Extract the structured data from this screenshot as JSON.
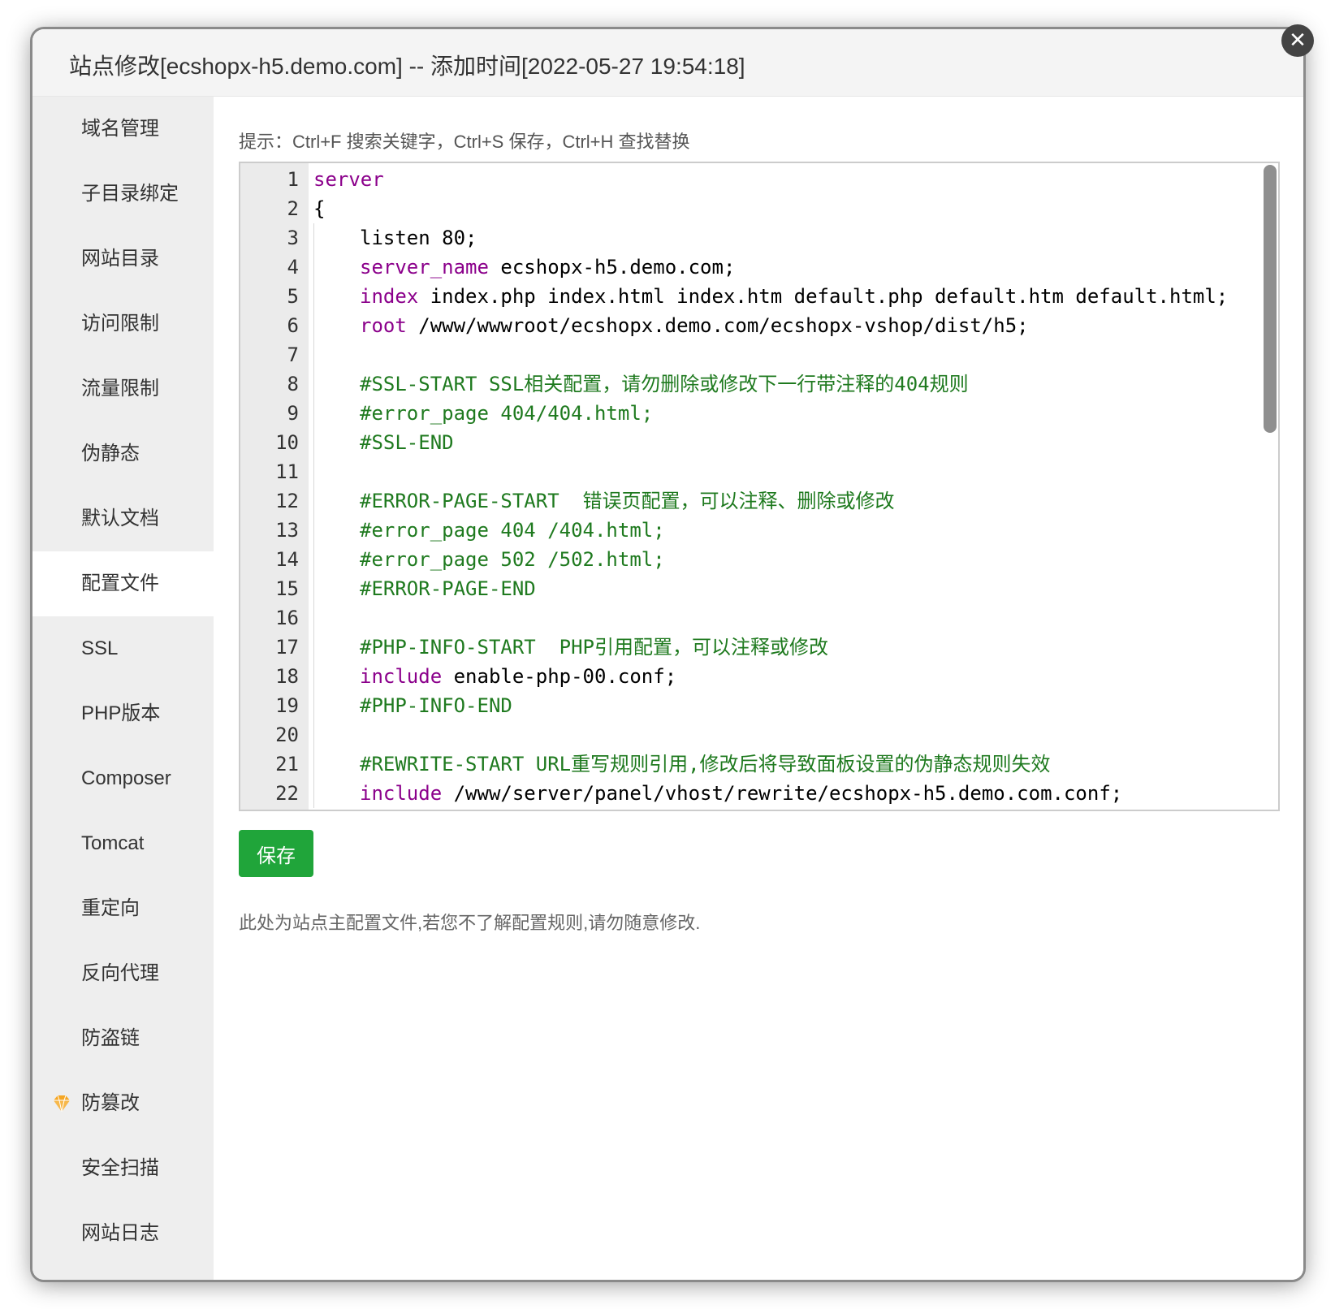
{
  "dialog": {
    "title": "站点修改[ecshopx-h5.demo.com] -- 添加时间[2022-05-27 19:54:18]",
    "close_icon": "close-icon"
  },
  "sidebar": {
    "items": [
      {
        "label": "域名管理"
      },
      {
        "label": "子目录绑定"
      },
      {
        "label": "网站目录"
      },
      {
        "label": "访问限制"
      },
      {
        "label": "流量限制"
      },
      {
        "label": "伪静态"
      },
      {
        "label": "默认文档"
      },
      {
        "label": "配置文件",
        "active": true
      },
      {
        "label": "SSL"
      },
      {
        "label": "PHP版本"
      },
      {
        "label": "Composer"
      },
      {
        "label": "Tomcat"
      },
      {
        "label": "重定向"
      },
      {
        "label": "反向代理"
      },
      {
        "label": "防盗链"
      },
      {
        "label": "防篡改",
        "icon": "gem-icon"
      },
      {
        "label": "安全扫描"
      },
      {
        "label": "网站日志"
      }
    ]
  },
  "editor": {
    "hint": "提示：Ctrl+F 搜索关键字，Ctrl+S 保存，Ctrl+H 查找替换",
    "lines": [
      {
        "n": "1",
        "indent": false,
        "kw": "server",
        "rest": "",
        "comment": ""
      },
      {
        "n": "2",
        "indent": false,
        "kw": "",
        "rest": "{",
        "comment": ""
      },
      {
        "n": "3",
        "indent": true,
        "kw": "",
        "rest": "listen 80;",
        "comment": ""
      },
      {
        "n": "4",
        "indent": true,
        "kw": "server_name",
        "rest": " ecshopx-h5.demo.com;",
        "comment": ""
      },
      {
        "n": "5",
        "indent": true,
        "kw": "index",
        "rest": " index.php index.html index.htm default.php default.htm default.html;",
        "comment": ""
      },
      {
        "n": "6",
        "indent": true,
        "kw": "root",
        "rest": " /www/wwwroot/ecshopx.demo.com/ecshopx-vshop/dist/h5;",
        "comment": ""
      },
      {
        "n": "7",
        "indent": true,
        "kw": "",
        "rest": "",
        "comment": ""
      },
      {
        "n": "8",
        "indent": true,
        "kw": "",
        "rest": "",
        "comment": "#SSL-START SSL相关配置，请勿删除或修改下一行带注释的404规则"
      },
      {
        "n": "9",
        "indent": true,
        "kw": "",
        "rest": "",
        "comment": "#error_page 404/404.html;"
      },
      {
        "n": "10",
        "indent": true,
        "kw": "",
        "rest": "",
        "comment": "#SSL-END"
      },
      {
        "n": "11",
        "indent": true,
        "kw": "",
        "rest": "",
        "comment": ""
      },
      {
        "n": "12",
        "indent": true,
        "kw": "",
        "rest": "",
        "comment": "#ERROR-PAGE-START  错误页配置，可以注释、删除或修改"
      },
      {
        "n": "13",
        "indent": true,
        "kw": "",
        "rest": "",
        "comment": "#error_page 404 /404.html;"
      },
      {
        "n": "14",
        "indent": true,
        "kw": "",
        "rest": "",
        "comment": "#error_page 502 /502.html;"
      },
      {
        "n": "15",
        "indent": true,
        "kw": "",
        "rest": "",
        "comment": "#ERROR-PAGE-END"
      },
      {
        "n": "16",
        "indent": true,
        "kw": "",
        "rest": "",
        "comment": ""
      },
      {
        "n": "17",
        "indent": true,
        "kw": "",
        "rest": "",
        "comment": "#PHP-INFO-START  PHP引用配置，可以注释或修改"
      },
      {
        "n": "18",
        "indent": true,
        "kw": "include",
        "rest": " enable-php-00.conf;",
        "comment": ""
      },
      {
        "n": "19",
        "indent": true,
        "kw": "",
        "rest": "",
        "comment": "#PHP-INFO-END"
      },
      {
        "n": "20",
        "indent": true,
        "kw": "",
        "rest": "",
        "comment": ""
      },
      {
        "n": "21",
        "indent": true,
        "kw": "",
        "rest": "",
        "comment": "#REWRITE-START URL重写规则引用,修改后将导致面板设置的伪静态规则失效"
      },
      {
        "n": "22",
        "indent": true,
        "kw": "include",
        "rest": " /www/server/panel/vhost/rewrite/ecshopx-h5.demo.com.conf;",
        "comment": ""
      }
    ],
    "save_label": "保存",
    "note": "此处为站点主配置文件,若您不了解配置规则,请勿随意修改."
  },
  "colors": {
    "keyword": "#8b008b",
    "comment": "#1f7a1f",
    "save_button": "#20a53a"
  }
}
